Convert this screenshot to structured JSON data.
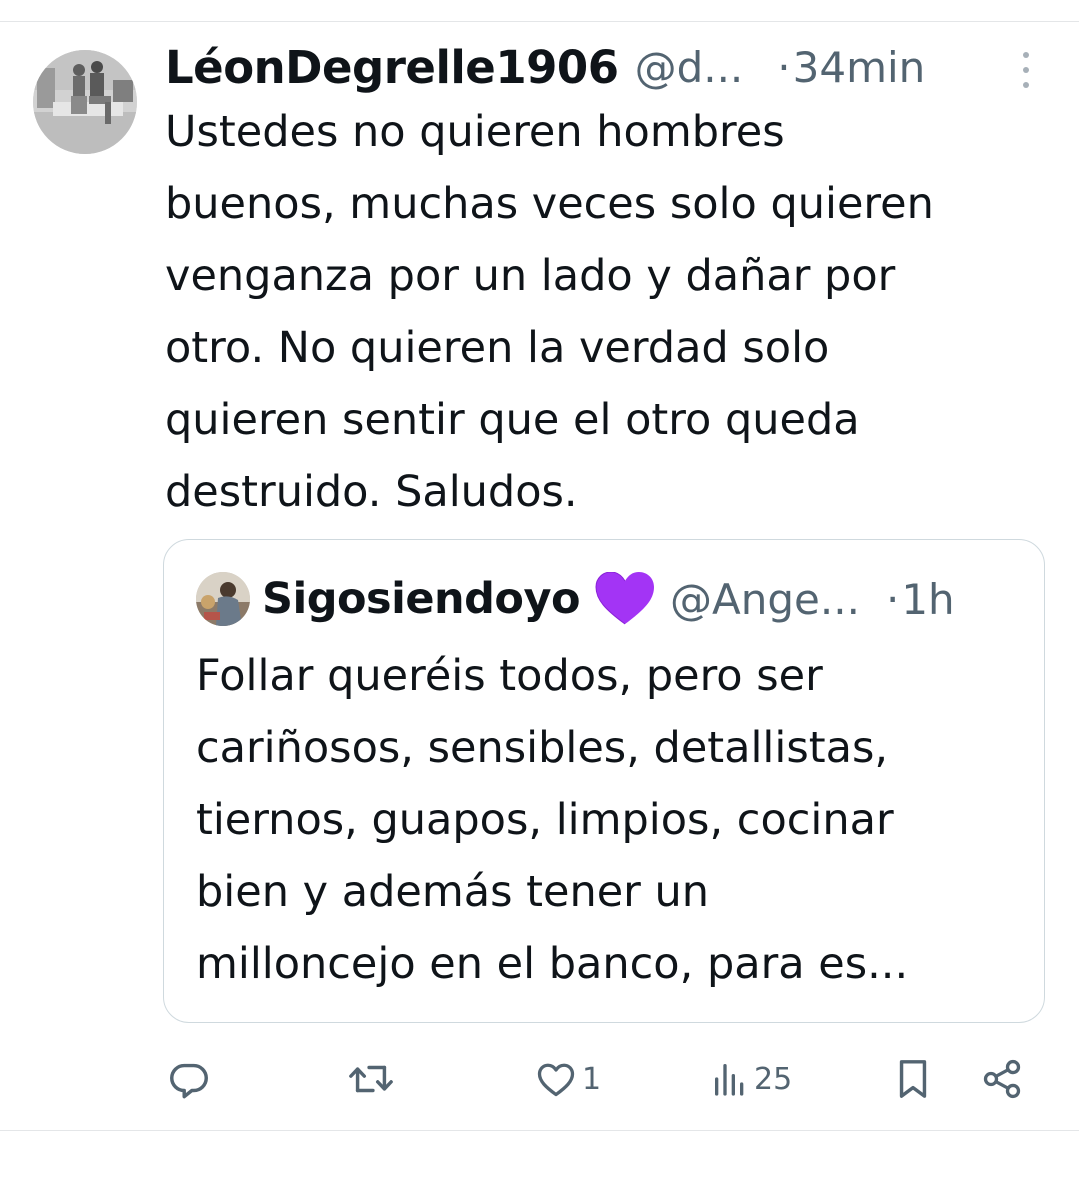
{
  "tweet": {
    "author_name": "LéonDegrelle1906",
    "handle": "@d...",
    "separator": "·",
    "time": "34min",
    "text": "Ustedes no quieren hombres\nbuenos, muchas veces solo quieren\nvenganza por un lado y dañar por\notro. No quieren la verdad solo\nquieren sentir que el otro queda\ndestruido. Saludos."
  },
  "quoted_tweet": {
    "author_name": "Sigosiendoyo",
    "name_emoji": "purple-heart-icon",
    "handle": "@Ange...",
    "separator": "·",
    "time": "1h",
    "text": "Follar queréis todos, pero ser\ncariñosos, sensibles, detallistas,\ntiernos, guapos, limpios, cocinar\nbien y además tener un\nmilloncejo en el banco, para es..."
  },
  "actions": {
    "reply": {
      "icon": "reply-icon"
    },
    "retweet": {
      "icon": "retweet-icon"
    },
    "like": {
      "icon": "heart-icon",
      "count": "1"
    },
    "views": {
      "icon": "views-icon",
      "count": "25"
    },
    "bookmark": {
      "icon": "bookmark-icon"
    },
    "share": {
      "icon": "share-icon"
    }
  },
  "colors": {
    "text": "#0f1419",
    "secondary": "#536471",
    "border": "#cfd9de",
    "heart_emoji": "#a334f5"
  }
}
